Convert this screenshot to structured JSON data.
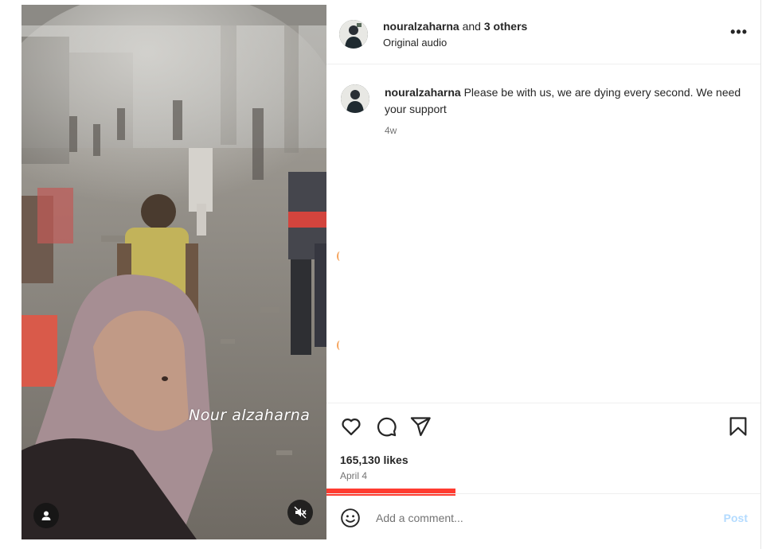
{
  "media": {
    "watermark": "Nour alzaharna"
  },
  "header": {
    "username": "nouralzaharna",
    "and_text": "and",
    "others": "3 others",
    "audio": "Original audio",
    "more": "•••"
  },
  "comment": {
    "username": "nouralzaharna",
    "text": "Please be with us, we are dying every second. We need your support",
    "time": "4w"
  },
  "stats": {
    "likes": "165,130 likes",
    "date": "April 4"
  },
  "comment_box": {
    "placeholder": "Add a comment...",
    "post_label": "Post"
  },
  "colors": {
    "progress": "#ff3b30",
    "post_disabled": "#b3dbff"
  },
  "icons": [
    "user-tag-icon",
    "muted-speaker-icon",
    "more-options-icon",
    "heart-icon",
    "comment-icon",
    "share-icon",
    "bookmark-icon",
    "emoji-icon"
  ]
}
